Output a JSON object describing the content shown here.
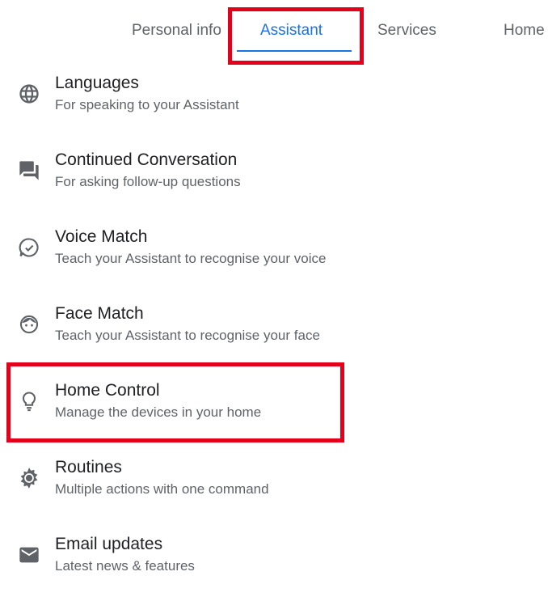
{
  "tabs": [
    {
      "label": "Personal info",
      "active": false
    },
    {
      "label": "Assistant",
      "active": true
    },
    {
      "label": "Services",
      "active": false
    },
    {
      "label": "Home",
      "active": false
    }
  ],
  "accent_color": "#1a73e8",
  "highlight_color": "#e3001b",
  "items": [
    {
      "title": "Languages",
      "subtitle": "For speaking to your Assistant",
      "icon": "globe-icon"
    },
    {
      "title": "Continued Conversation",
      "subtitle": "For asking follow-up questions",
      "icon": "chat-icon"
    },
    {
      "title": "Voice Match",
      "subtitle": "Teach your Assistant to recognise your voice",
      "icon": "voice-match-icon"
    },
    {
      "title": "Face Match",
      "subtitle": "Teach your Assistant to recognise your face",
      "icon": "face-icon"
    },
    {
      "title": "Home Control",
      "subtitle": "Manage the devices in your home",
      "icon": "lightbulb-icon"
    },
    {
      "title": "Routines",
      "subtitle": "Multiple actions with one command",
      "icon": "routines-icon"
    },
    {
      "title": "Email updates",
      "subtitle": "Latest news & features",
      "icon": "email-icon"
    }
  ]
}
